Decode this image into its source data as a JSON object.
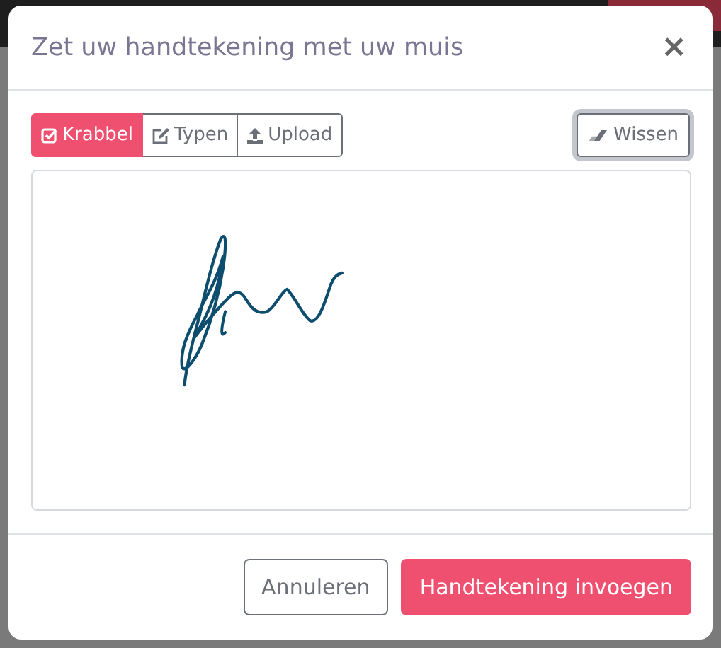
{
  "dialog": {
    "title": "Zet uw handtekening met uw muis",
    "close": "×"
  },
  "tabs": [
    {
      "label": "Krabbel",
      "kind": "checkbox",
      "selected": true
    },
    {
      "label": "Typen",
      "kind": "edit",
      "selected": false
    },
    {
      "label": "Upload",
      "kind": "upload",
      "selected": false
    }
  ],
  "clear_button": "Wissen",
  "buttons": [
    {
      "label": "Annuleren",
      "kind": "secondary"
    },
    {
      "label": "Handtekening invoegen",
      "kind": "primary"
    }
  ]
}
